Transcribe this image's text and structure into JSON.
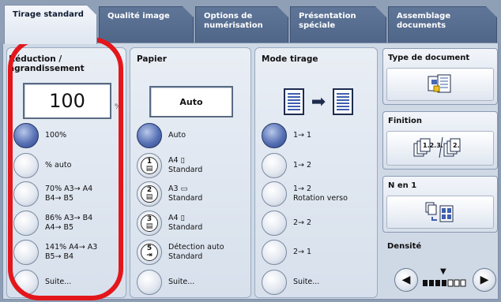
{
  "tabs": [
    {
      "label": "Tirage standard"
    },
    {
      "label": "Qualité image"
    },
    {
      "label": "Options de numérisation"
    },
    {
      "label": "Présentation spéciale"
    },
    {
      "label": "Assemblage documents"
    }
  ],
  "reduction": {
    "title": "Réduction / agrandissement",
    "value": "100",
    "unit": "%",
    "options": [
      {
        "label": "100%",
        "selected": true
      },
      {
        "label": "% auto"
      },
      {
        "label": "70% A3→ A4\nB4→ B5"
      },
      {
        "label": "86% A3→ B4\nA4→ B5"
      },
      {
        "label": "141% A4→ A3\nB5→ B4"
      },
      {
        "label": "Suite..."
      }
    ]
  },
  "paper": {
    "title": "Papier",
    "value": "Auto",
    "options": [
      {
        "label": "Auto",
        "selected": true
      },
      {
        "label": "A4 ▯\nStandard",
        "tray": "1"
      },
      {
        "label": "A3 ▭\nStandard",
        "tray": "2"
      },
      {
        "label": "A4 ▯\nStandard",
        "tray": "3"
      },
      {
        "label": "Détection auto\nStandard",
        "tray": "5"
      },
      {
        "label": "Suite..."
      }
    ]
  },
  "mode": {
    "title": "Mode tirage",
    "options": [
      {
        "label": "1→ 1",
        "selected": true
      },
      {
        "label": "1→ 2"
      },
      {
        "label": "1→ 2\nRotation verso"
      },
      {
        "label": "2→ 2"
      },
      {
        "label": "2→ 1"
      },
      {
        "label": "Suite..."
      }
    ]
  },
  "right": {
    "doc_type": "Type de document",
    "finishing": "Finition",
    "n_up": "N en 1",
    "density": "Densité"
  },
  "colors": {
    "accent_selected": "#4a63a8",
    "annotation": "#e3161b"
  }
}
